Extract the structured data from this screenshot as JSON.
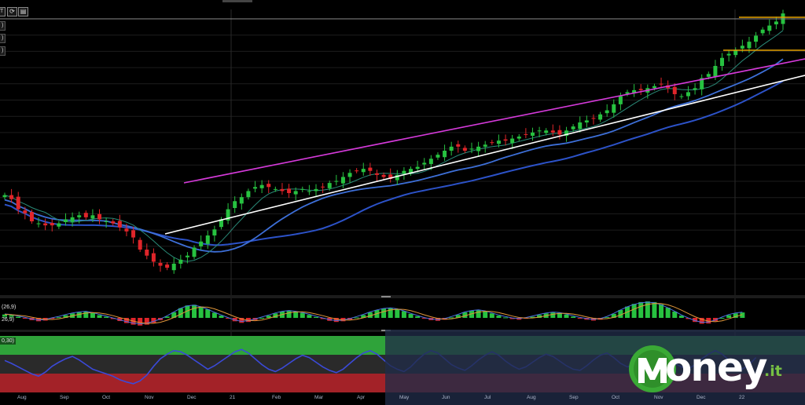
{
  "toolbar": {
    "symbol_label": "T",
    "buttons": [
      {
        "name": "refresh-icon",
        "glyph": "⟳"
      },
      {
        "name": "chart-type-icon",
        "glyph": "▤"
      }
    ]
  },
  "indicators": {
    "ma_badges": [
      ")",
      ")",
      ")"
    ],
    "macd_label": "(26,9)",
    "macd_label2": "26,9)",
    "rsi_label": "0,30)"
  },
  "brand": {
    "name": "oney",
    "tld": ".it",
    "colors": {
      "green": "#3aa935",
      "dark_green": "#1f6e1a"
    }
  },
  "colors": {
    "up": "#27c240",
    "down": "#e0252a",
    "ma_fast": "#2a8a78",
    "ma_mid": "#3d6fd8",
    "ma_slow": "#2c52c8",
    "trend_upper": "#d63adb",
    "trend_lower": "#ffffff",
    "resistance": "#e5a100",
    "macd": "#4a6fe0",
    "signal": "#e0963a",
    "rsi": "#3b4ad8"
  },
  "chart_data": {
    "type": "candlestick",
    "x_ticks": [
      "Aug",
      "Sep",
      "Oct",
      "Nov",
      "Dec",
      "21",
      "Feb",
      "Mar",
      "Apr",
      "May",
      "Jun",
      "Jul",
      "Aug",
      "Sep",
      "Oct",
      "Nov",
      "Dec",
      "22"
    ],
    "closes": [
      48,
      46,
      41,
      39,
      35,
      34,
      33,
      33,
      34,
      36,
      37,
      38,
      37,
      38,
      36,
      35,
      34,
      32,
      30,
      27,
      21,
      18,
      15,
      13,
      12,
      14,
      16,
      18,
      22,
      25,
      28,
      31,
      36,
      41,
      45,
      47,
      50,
      52,
      53,
      52,
      51,
      50,
      49,
      50,
      51,
      50,
      51,
      52,
      54,
      55,
      57,
      59,
      60,
      61,
      60,
      58,
      57,
      56,
      58,
      60,
      61,
      62,
      64,
      66,
      68,
      70,
      72,
      72,
      70,
      71,
      72,
      73,
      74,
      75,
      75,
      76,
      77,
      78,
      79,
      80,
      80,
      79,
      78,
      80,
      82,
      84,
      85,
      86,
      88,
      90,
      93,
      97,
      99,
      100,
      100,
      101,
      102,
      103,
      101,
      98,
      97,
      99,
      101,
      106,
      108,
      112,
      116,
      118,
      120,
      122,
      124,
      127,
      130,
      132,
      134,
      138
    ],
    "macd": [
      1.5,
      1.2,
      0.5,
      -0.2,
      -1.0,
      -1.5,
      -1.2,
      -0.4,
      0.3,
      1.2,
      2.0,
      2.5,
      2.8,
      2.2,
      1.2,
      0.5,
      -0.5,
      -1.4,
      -2.3,
      -3.0,
      -3.4,
      -3.0,
      -2.2,
      -1.0,
      0.6,
      2.5,
      4.3,
      5.5,
      5.8,
      5.0,
      3.8,
      2.3,
      1.0,
      -0.3,
      -1.5,
      -2.2,
      -1.8,
      -1.0,
      0.0,
      1.0,
      2.0,
      2.8,
      3.2,
      2.8,
      2.2,
      1.3,
      0.4,
      -0.5,
      -1.3,
      -1.8,
      -1.5,
      -0.8,
      0.2,
      1.3,
      2.5,
      3.5,
      4.2,
      4.5,
      4.0,
      3.0,
      1.8,
      0.7,
      -0.3,
      -1.0,
      -1.3,
      -0.8,
      0.2,
      1.3,
      2.5,
      3.2,
      3.5,
      3.0,
      2.0,
      1.0,
      0.2,
      -0.5,
      -0.8,
      -0.3,
      0.5,
      1.3,
      2.0,
      2.4,
      2.2,
      1.5,
      0.6,
      -0.2,
      -0.8,
      -1.2,
      -0.8,
      0.3,
      1.8,
      3.5,
      5.0,
      6.2,
      7.0,
      7.3,
      7.0,
      6.0,
      4.5,
      2.8,
      1.0,
      -0.5,
      -1.8,
      -2.6,
      -2.5,
      -1.5,
      0.0,
      1.2,
      2.0,
      2.4
    ],
    "rsi": [
      55,
      50,
      44,
      38,
      32,
      28,
      35,
      45,
      52,
      58,
      62,
      56,
      48,
      40,
      36,
      32,
      28,
      22,
      18,
      15,
      20,
      30,
      45,
      58,
      66,
      72,
      70,
      64,
      56,
      48,
      40,
      46,
      54,
      62,
      70,
      74,
      68,
      58,
      48,
      40,
      36,
      42,
      50,
      58,
      64,
      60,
      52,
      44,
      38,
      34,
      40,
      50,
      60,
      68,
      72,
      66,
      56,
      46,
      40,
      36,
      44,
      56,
      66,
      72,
      68,
      58,
      48,
      42,
      38,
      46,
      56,
      64,
      70,
      64,
      54,
      46,
      40,
      44,
      52,
      60,
      66,
      62,
      54,
      46,
      40,
      38,
      46,
      56,
      64,
      68,
      60,
      50,
      44,
      48,
      58,
      68,
      74,
      70,
      60,
      50,
      44,
      40,
      48,
      58,
      66,
      72,
      66,
      56,
      46,
      40,
      48,
      60
    ],
    "y_range": [
      0,
      140
    ]
  }
}
